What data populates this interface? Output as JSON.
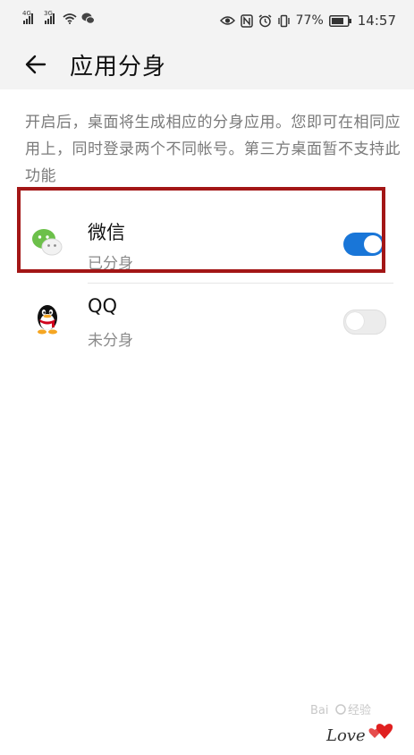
{
  "statusbar": {
    "signal1_tag": "4G",
    "signal2_tag": "3G",
    "battery_text": "77%",
    "time": "14:57"
  },
  "appbar": {
    "title": "应用分身"
  },
  "description": "开启后，桌面将生成相应的分身应用。您即可在相同应用上，同时登录两个不同帐号。第三方桌面暂不支持此功能",
  "apps": [
    {
      "name": "微信",
      "status": "已分身",
      "enabled": true,
      "icon": "wechat-icon"
    },
    {
      "name": "QQ",
      "status": "未分身",
      "enabled": false,
      "icon": "qq-icon"
    }
  ],
  "colors": {
    "accent": "#1976d8",
    "highlight": "#a31616",
    "background": "#f3f3f3"
  },
  "watermark": "Baidu经验"
}
